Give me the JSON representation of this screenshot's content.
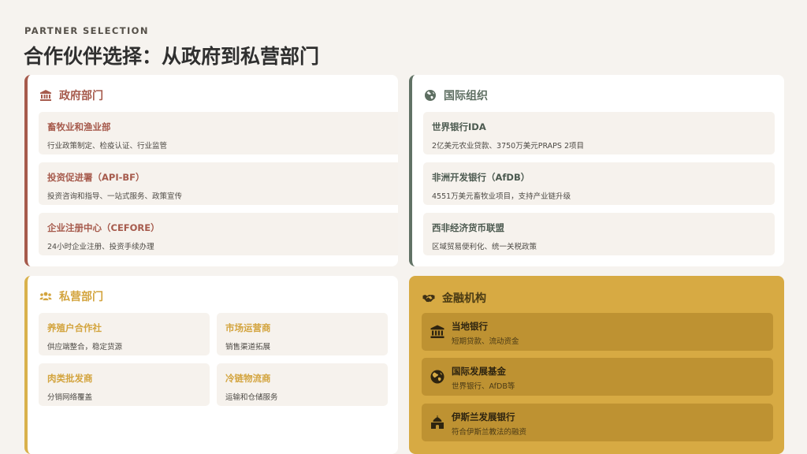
{
  "header": {
    "eyebrow": "PARTNER SELECTION",
    "title": "合作伙伴选择：从政府到私营部门"
  },
  "government": {
    "title": "政府部门",
    "icon": "government-building-icon",
    "items": [
      {
        "name": "畜牧业和渔业部",
        "desc": "行业政策制定、检疫认证、行业监管"
      },
      {
        "name": "投资促进署（API-BF）",
        "desc": "投资咨询和指导、一站式服务、政策宣传"
      },
      {
        "name": "企业注册中心（CEFORE）",
        "desc": "24小时企业注册、投资手续办理"
      }
    ]
  },
  "international": {
    "title": "国际组织",
    "icon": "globe-icon",
    "items": [
      {
        "name": "世界银行IDA",
        "desc": "2亿美元农业贷款、3750万美元PRAPS 2项目"
      },
      {
        "name": "非洲开发银行（AfDB）",
        "desc": "4551万美元畜牧业项目，支持产业链升级"
      },
      {
        "name": "西非经济货币联盟",
        "desc": "区域贸易便利化、统一关税政策"
      }
    ]
  },
  "private": {
    "title": "私营部门",
    "icon": "people-group-icon",
    "items": [
      {
        "name": "养殖户合作社",
        "desc": "供应端整合，稳定货源"
      },
      {
        "name": "市场运营商",
        "desc": "销售渠道拓展"
      },
      {
        "name": "肉类批发商",
        "desc": "分销网络覆盖"
      },
      {
        "name": "冷链物流商",
        "desc": "运输和仓储服务"
      }
    ]
  },
  "finance": {
    "title": "金融机构",
    "icon": "handshake-icon",
    "items": [
      {
        "name": "当地银行",
        "desc": "短期贷款、流动资金",
        "icon": "bank-icon"
      },
      {
        "name": "国际发展基金",
        "desc": "世界银行、AfDB等",
        "icon": "globe-africa-icon"
      },
      {
        "name": "伊斯兰发展银行",
        "desc": "符合伊斯兰教法的融资",
        "icon": "mosque-icon"
      }
    ]
  },
  "colors": {
    "background": "#f6f3ef",
    "government": "#a65a4c",
    "international": "#617265",
    "private": "#d9b14c",
    "finance": "#d7aa43"
  }
}
